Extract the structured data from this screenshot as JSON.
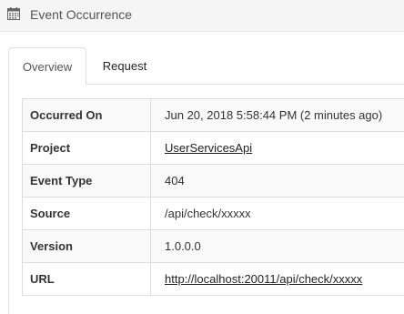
{
  "header": {
    "icon": "calendar-icon",
    "title": "Event Occurrence"
  },
  "tabs": [
    {
      "label": "Overview",
      "active": true
    },
    {
      "label": "Request",
      "active": false
    }
  ],
  "details": [
    {
      "label": "Occurred On",
      "value": "Jun 20, 2018 5:58:44 PM (2 minutes ago)",
      "link": false
    },
    {
      "label": "Project",
      "value": "UserServicesApi",
      "link": true
    },
    {
      "label": "Event Type",
      "value": "404",
      "link": false
    },
    {
      "label": "Source",
      "value": "/api/check/xxxxx",
      "link": false
    },
    {
      "label": "Version",
      "value": "1.0.0.0",
      "link": false
    },
    {
      "label": "URL",
      "value": "http://localhost:20011/api/check/xxxxx",
      "link": true
    }
  ],
  "colors": {
    "header_bg": "#f5f5f5",
    "border": "#dddddd",
    "striped_row": "#f9f9f9"
  }
}
